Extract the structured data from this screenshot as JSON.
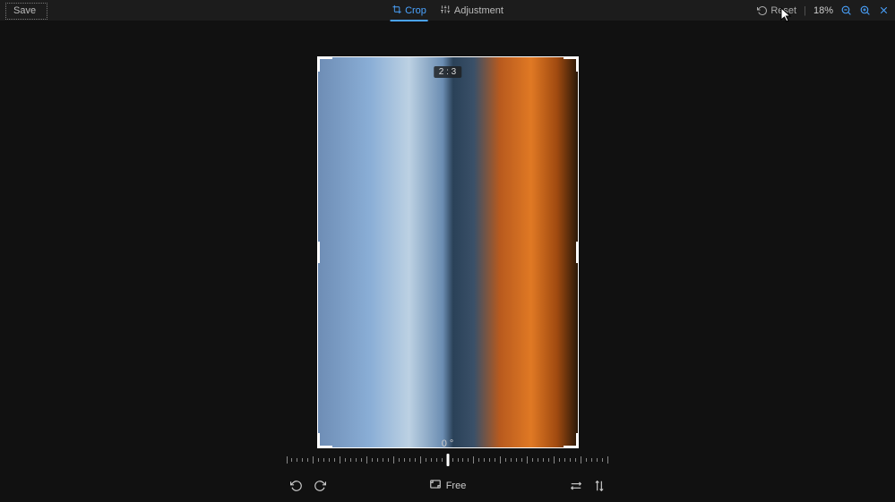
{
  "toolbar": {
    "save_label": "Save",
    "tabs": {
      "crop": "Crop",
      "adjustment": "Adjustment"
    },
    "reset_label": "Reset",
    "zoom_label": "18%"
  },
  "crop": {
    "ratio_label": "2 : 3"
  },
  "controls": {
    "angle_label": "0 °",
    "aspect_mode_label": "Free"
  },
  "icons": {
    "crop": "crop",
    "sliders": "sliders",
    "undo": "undo",
    "zoom_in": "zoom-in",
    "zoom_out": "zoom-out",
    "close": "close",
    "rotate_ccw": "rotate-ccw",
    "rotate_cw": "rotate-cw",
    "aspect_ratio": "aspect-ratio",
    "flip_h": "flip-horizontal",
    "flip_v": "flip-vertical"
  }
}
